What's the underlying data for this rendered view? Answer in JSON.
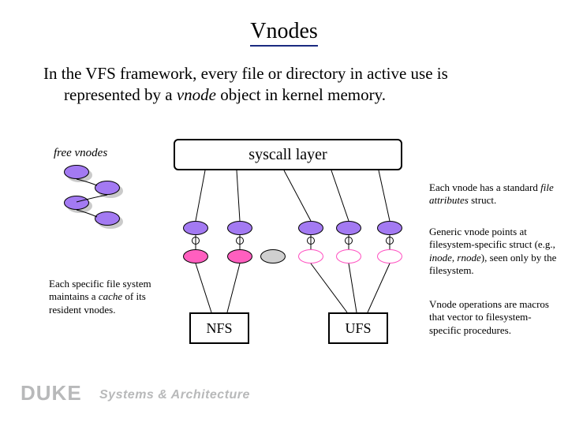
{
  "title": "Vnodes",
  "intro": {
    "line1": "In the VFS framework, every file or directory in active use is",
    "line2_pre": "represented by a ",
    "line2_em": "vnode",
    "line2_post": " object in kernel memory."
  },
  "syscall_label": "syscall layer",
  "free_vnodes_label": "free vnodes",
  "cache_note": {
    "pre": "Each specific file system maintains a ",
    "em": "cache",
    "post": " of its resident vnodes."
  },
  "notes": {
    "attr": {
      "pre": "Each vnode has a standard ",
      "em": "file attributes",
      "post": " struct."
    },
    "generic": {
      "pre": "Generic vnode points at filesystem-specific struct (e.g., ",
      "em1": "inode",
      "mid": ", ",
      "em2": "rnode",
      "post": "), seen only by the filesystem."
    },
    "ops": "Vnode operations are macros that vector to filesystem-specific procedures."
  },
  "fs": {
    "nfs": "NFS",
    "ufs": "UFS"
  },
  "footer": {
    "brand": "DUKE",
    "sub": "Systems & Architecture"
  },
  "colors": {
    "purple": "#a37af2",
    "pink": "#ff5fbf",
    "gray": "#cfcfcf"
  }
}
